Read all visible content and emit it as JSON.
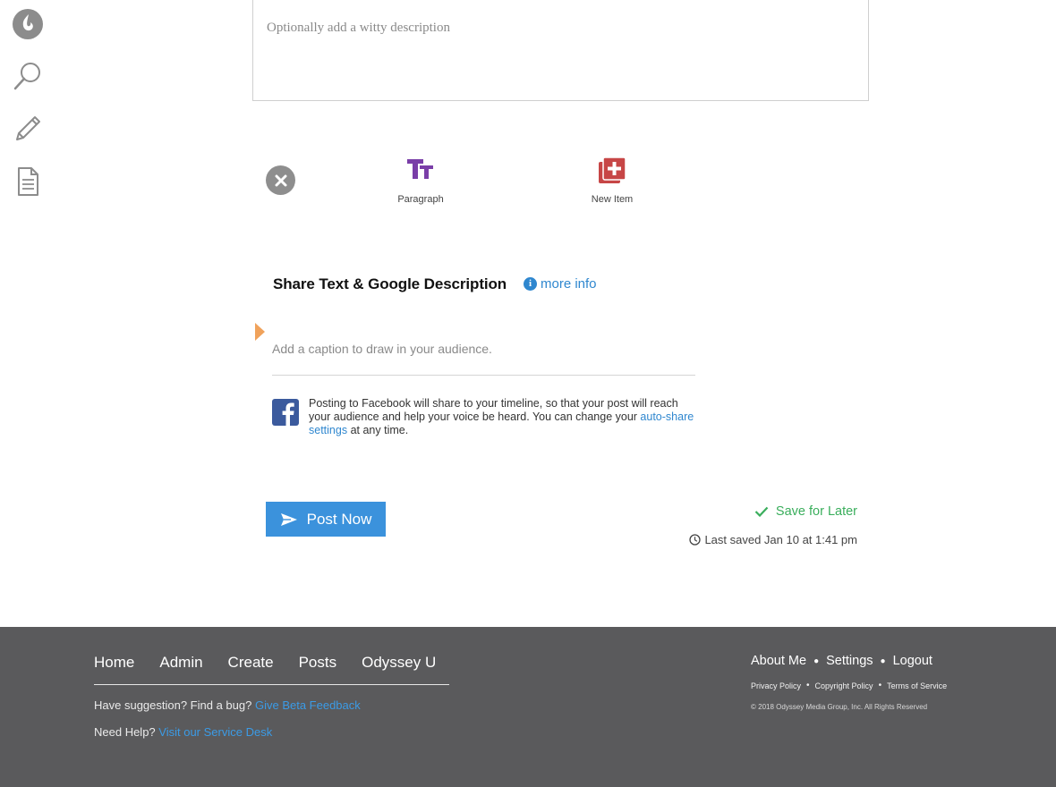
{
  "rail": {
    "items": [
      {
        "icon": "odyssey-flame-logo-icon"
      },
      {
        "icon": "search-icon"
      },
      {
        "icon": "pencil-icon"
      },
      {
        "icon": "document-icon"
      }
    ]
  },
  "editor": {
    "description_placeholder": "Optionally add a witty description"
  },
  "toolbar": {
    "close_icon": "close-icon",
    "paragraph_label": "Paragraph",
    "new_item_label": "New Item",
    "paragraph_color": "#7a3ea8",
    "new_item_color": "#c74646"
  },
  "share": {
    "title": "Share Text & Google Description",
    "more_info": "more info",
    "caption_placeholder": "Add a caption to draw in your audience.",
    "fb_note_prefix": "Posting to Facebook will share to your timeline, so that your post will reach your audience and help your voice be heard. You can change your",
    "fb_note_link": "auto-share settings",
    "fb_note_suffix": "at any time."
  },
  "actions": {
    "post_now": "Post Now",
    "save_for_later": "Save for Later",
    "last_saved": "Last saved Jan 10 at 1:41 pm",
    "post_color": "#3b92dc",
    "save_color": "#3aae5c"
  },
  "footer": {
    "nav": [
      "Home",
      "Admin",
      "Create",
      "Posts",
      "Odyssey U"
    ],
    "suggestion_text": "Have suggestion? Find a bug?",
    "suggestion_link": "Give Beta Feedback",
    "help_text": "Need Help?",
    "help_link": "Visit our Service Desk",
    "account_links": [
      "About Me",
      "Settings",
      "Logout"
    ],
    "legal_links": [
      "Privacy Policy",
      "Copyright Policy",
      "Terms of Service"
    ],
    "copyright": "© 2018 Odyssey Media Group, Inc. All Rights Reserved",
    "background": "#5a5a5c"
  }
}
